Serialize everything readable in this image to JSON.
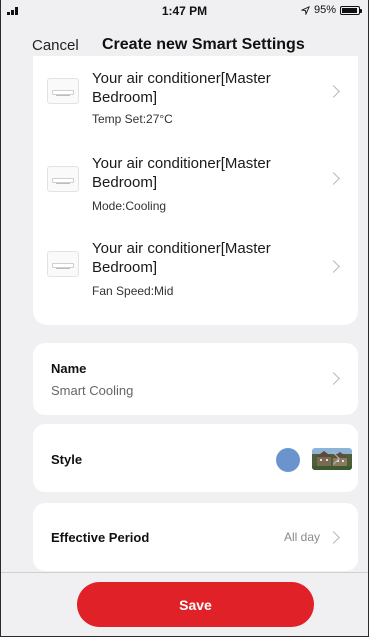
{
  "status_bar": {
    "time": "1:47 PM",
    "battery_text": "95%",
    "battery_level": 0.95,
    "location_icon": "location-arrow-icon"
  },
  "nav": {
    "cancel_label": "Cancel",
    "title": "Create new Smart Settings"
  },
  "actions": [
    {
      "title": "Your air conditioner[Master Bedroom]",
      "detail": "Temp Set:27°C",
      "icon": "air-conditioner-icon"
    },
    {
      "title": "Your air conditioner[Master Bedroom]",
      "detail": "Mode:Cooling",
      "icon": "air-conditioner-icon"
    },
    {
      "title": "Your air conditioner[Master Bedroom]",
      "detail": "Fan Speed:Mid",
      "icon": "air-conditioner-icon"
    }
  ],
  "name_row": {
    "label": "Name",
    "value": "Smart Cooling"
  },
  "style_row": {
    "label": "Style",
    "color": "#6b94cf"
  },
  "period_row": {
    "label": "Effective Period",
    "value": "All day"
  },
  "save_button": {
    "label": "Save",
    "color": "#e02127"
  },
  "colors": {
    "background": "#f0f0f2",
    "card": "#ffffff",
    "accent_red": "#e02127"
  }
}
